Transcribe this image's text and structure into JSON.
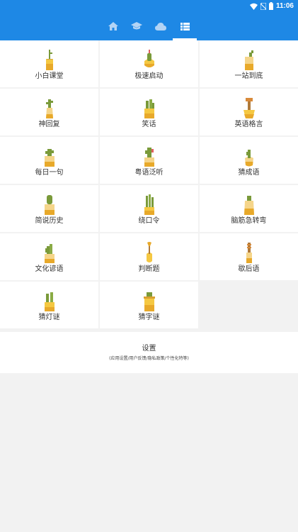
{
  "status": {
    "time": "11:06"
  },
  "tabs": [
    {
      "icon": "home-icon"
    },
    {
      "icon": "graduation-cap-icon"
    },
    {
      "icon": "cloud-icon"
    },
    {
      "icon": "list-icon"
    }
  ],
  "items": [
    "小白课堂",
    "极速启动",
    "一站到底",
    "神回复",
    "笑话",
    "英语格言",
    "每日一句",
    "粤语泛听",
    "猜成语",
    "简说历史",
    "绕口令",
    "脑筋急转弯",
    "文化谚语",
    "判断题",
    "歇后语",
    "猜灯谜",
    "猜字谜"
  ],
  "settings": {
    "title": "设置",
    "subtitle": "(应用设置/用户反馈/隐私政策/个性化特等)"
  }
}
